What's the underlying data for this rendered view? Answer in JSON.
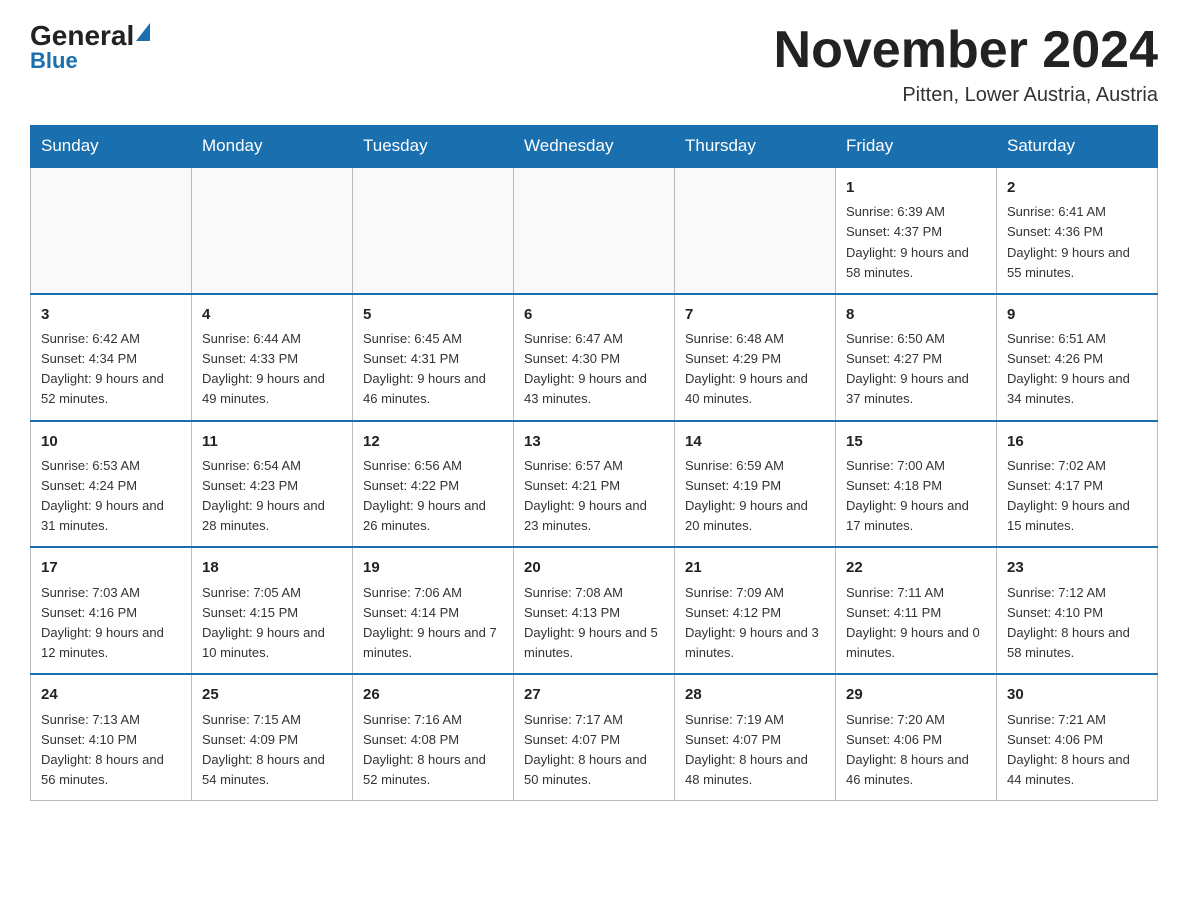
{
  "header": {
    "logo_general": "General",
    "logo_blue": "Blue",
    "month_title": "November 2024",
    "location": "Pitten, Lower Austria, Austria"
  },
  "days_of_week": [
    "Sunday",
    "Monday",
    "Tuesday",
    "Wednesday",
    "Thursday",
    "Friday",
    "Saturday"
  ],
  "weeks": [
    {
      "days": [
        {
          "number": "",
          "info": ""
        },
        {
          "number": "",
          "info": ""
        },
        {
          "number": "",
          "info": ""
        },
        {
          "number": "",
          "info": ""
        },
        {
          "number": "",
          "info": ""
        },
        {
          "number": "1",
          "info": "Sunrise: 6:39 AM\nSunset: 4:37 PM\nDaylight: 9 hours and 58 minutes."
        },
        {
          "number": "2",
          "info": "Sunrise: 6:41 AM\nSunset: 4:36 PM\nDaylight: 9 hours and 55 minutes."
        }
      ]
    },
    {
      "days": [
        {
          "number": "3",
          "info": "Sunrise: 6:42 AM\nSunset: 4:34 PM\nDaylight: 9 hours and 52 minutes."
        },
        {
          "number": "4",
          "info": "Sunrise: 6:44 AM\nSunset: 4:33 PM\nDaylight: 9 hours and 49 minutes."
        },
        {
          "number": "5",
          "info": "Sunrise: 6:45 AM\nSunset: 4:31 PM\nDaylight: 9 hours and 46 minutes."
        },
        {
          "number": "6",
          "info": "Sunrise: 6:47 AM\nSunset: 4:30 PM\nDaylight: 9 hours and 43 minutes."
        },
        {
          "number": "7",
          "info": "Sunrise: 6:48 AM\nSunset: 4:29 PM\nDaylight: 9 hours and 40 minutes."
        },
        {
          "number": "8",
          "info": "Sunrise: 6:50 AM\nSunset: 4:27 PM\nDaylight: 9 hours and 37 minutes."
        },
        {
          "number": "9",
          "info": "Sunrise: 6:51 AM\nSunset: 4:26 PM\nDaylight: 9 hours and 34 minutes."
        }
      ]
    },
    {
      "days": [
        {
          "number": "10",
          "info": "Sunrise: 6:53 AM\nSunset: 4:24 PM\nDaylight: 9 hours and 31 minutes."
        },
        {
          "number": "11",
          "info": "Sunrise: 6:54 AM\nSunset: 4:23 PM\nDaylight: 9 hours and 28 minutes."
        },
        {
          "number": "12",
          "info": "Sunrise: 6:56 AM\nSunset: 4:22 PM\nDaylight: 9 hours and 26 minutes."
        },
        {
          "number": "13",
          "info": "Sunrise: 6:57 AM\nSunset: 4:21 PM\nDaylight: 9 hours and 23 minutes."
        },
        {
          "number": "14",
          "info": "Sunrise: 6:59 AM\nSunset: 4:19 PM\nDaylight: 9 hours and 20 minutes."
        },
        {
          "number": "15",
          "info": "Sunrise: 7:00 AM\nSunset: 4:18 PM\nDaylight: 9 hours and 17 minutes."
        },
        {
          "number": "16",
          "info": "Sunrise: 7:02 AM\nSunset: 4:17 PM\nDaylight: 9 hours and 15 minutes."
        }
      ]
    },
    {
      "days": [
        {
          "number": "17",
          "info": "Sunrise: 7:03 AM\nSunset: 4:16 PM\nDaylight: 9 hours and 12 minutes."
        },
        {
          "number": "18",
          "info": "Sunrise: 7:05 AM\nSunset: 4:15 PM\nDaylight: 9 hours and 10 minutes."
        },
        {
          "number": "19",
          "info": "Sunrise: 7:06 AM\nSunset: 4:14 PM\nDaylight: 9 hours and 7 minutes."
        },
        {
          "number": "20",
          "info": "Sunrise: 7:08 AM\nSunset: 4:13 PM\nDaylight: 9 hours and 5 minutes."
        },
        {
          "number": "21",
          "info": "Sunrise: 7:09 AM\nSunset: 4:12 PM\nDaylight: 9 hours and 3 minutes."
        },
        {
          "number": "22",
          "info": "Sunrise: 7:11 AM\nSunset: 4:11 PM\nDaylight: 9 hours and 0 minutes."
        },
        {
          "number": "23",
          "info": "Sunrise: 7:12 AM\nSunset: 4:10 PM\nDaylight: 8 hours and 58 minutes."
        }
      ]
    },
    {
      "days": [
        {
          "number": "24",
          "info": "Sunrise: 7:13 AM\nSunset: 4:10 PM\nDaylight: 8 hours and 56 minutes."
        },
        {
          "number": "25",
          "info": "Sunrise: 7:15 AM\nSunset: 4:09 PM\nDaylight: 8 hours and 54 minutes."
        },
        {
          "number": "26",
          "info": "Sunrise: 7:16 AM\nSunset: 4:08 PM\nDaylight: 8 hours and 52 minutes."
        },
        {
          "number": "27",
          "info": "Sunrise: 7:17 AM\nSunset: 4:07 PM\nDaylight: 8 hours and 50 minutes."
        },
        {
          "number": "28",
          "info": "Sunrise: 7:19 AM\nSunset: 4:07 PM\nDaylight: 8 hours and 48 minutes."
        },
        {
          "number": "29",
          "info": "Sunrise: 7:20 AM\nSunset: 4:06 PM\nDaylight: 8 hours and 46 minutes."
        },
        {
          "number": "30",
          "info": "Sunrise: 7:21 AM\nSunset: 4:06 PM\nDaylight: 8 hours and 44 minutes."
        }
      ]
    }
  ]
}
